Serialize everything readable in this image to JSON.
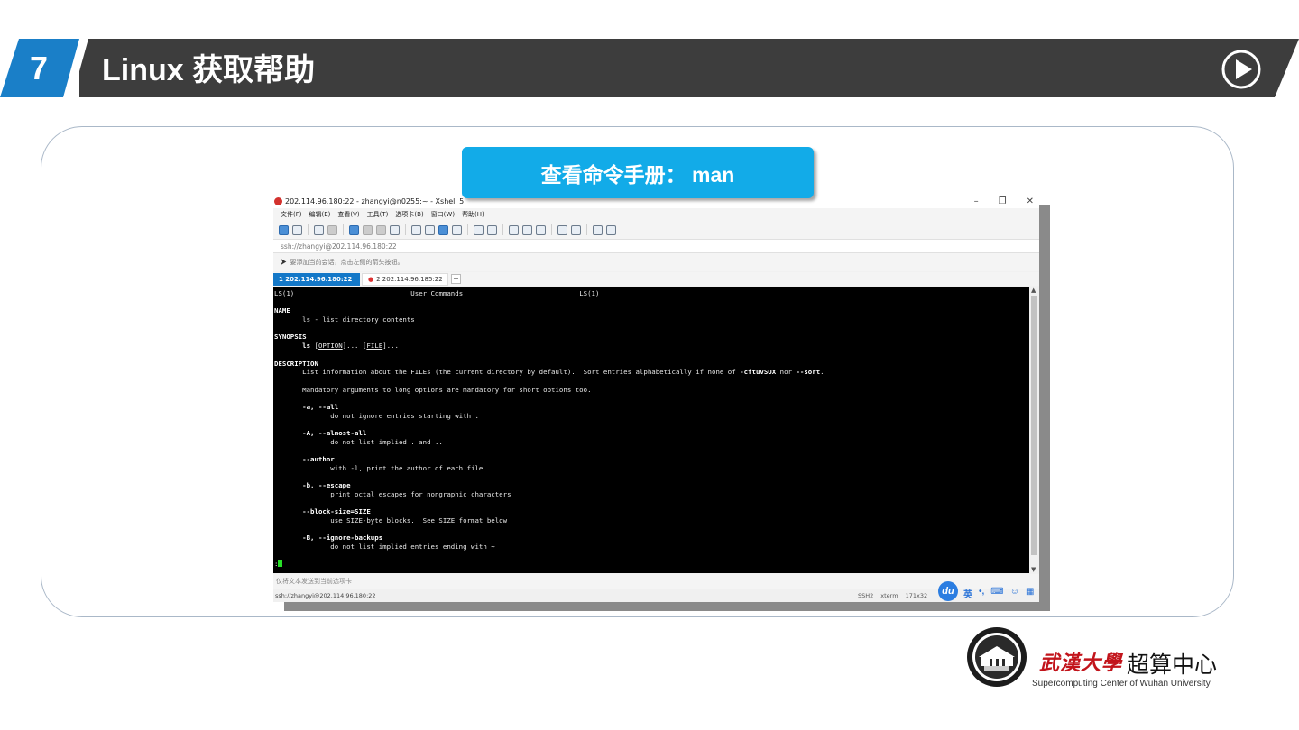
{
  "slide": {
    "number": "7",
    "title": "Linux 获取帮助",
    "caption": "查看命令手册： man"
  },
  "xshell": {
    "title": "202.114.96.180:22 - zhangyi@n0255:~ - Xshell 5",
    "window_controls": [
      "–",
      "❐",
      "✕"
    ],
    "menus": [
      "文件(F)",
      "编辑(E)",
      "查看(V)",
      "工具(T)",
      "选项卡(B)",
      "窗口(W)",
      "帮助(H)"
    ],
    "address": "ssh://zhangyi@202.114.96.180:22",
    "hint": "要添加当前会话，点击左侧的箭头按钮。",
    "tabs": [
      {
        "label": "1 202.114.96.180:22"
      },
      {
        "label": "2 202.114.96.185:22"
      }
    ],
    "tab_add": "+",
    "send_bar": "仅将文本发送到当前选项卡",
    "status_left": "ssh://zhangyi@202.114.96.180:22",
    "status_protocol": "SSH2",
    "status_term": "xterm",
    "status_size": "171x32",
    "ime_badge": "du",
    "ime_lang": "英"
  },
  "terminal": {
    "header_left": "LS(1)",
    "header_mid": "User Commands",
    "header_right": "LS(1)",
    "name_heading": "NAME",
    "name_text": "ls - list directory contents",
    "synopsis_heading": "SYNOPSIS",
    "synopsis_cmd": "ls",
    "synopsis_opt": "OPTION",
    "synopsis_file": "FILE",
    "description_heading": "DESCRIPTION",
    "desc_line1": "List information about the FILEs (the current directory by default).  Sort entries alphabetically if none of ",
    "desc_flags": "-cftuvSUX",
    "desc_nor": " nor ",
    "desc_sort": "--sort",
    "desc_line2": "Mandatory arguments to long options are mandatory for short options too.",
    "options": [
      {
        "flag": "-a, --all",
        "desc": "do not ignore entries starting with ."
      },
      {
        "flag": "-A, --almost-all",
        "desc": "do not list implied . and .."
      },
      {
        "flag": "--author",
        "desc": "with -l, print the author of each file"
      },
      {
        "flag": "-b, --escape",
        "desc": "print octal escapes for nongraphic characters"
      },
      {
        "flag": "--block-size=SIZE",
        "desc": "use SIZE-byte blocks.  See SIZE format below"
      },
      {
        "flag": "-B, --ignore-backups",
        "desc": "do not list implied entries ending with ~"
      }
    ],
    "prompt": ":"
  },
  "footer": {
    "university_cn": "武漢大學",
    "center_cn": "超算中心",
    "center_en": "Supercomputing Center of Wuhan University"
  },
  "colors": {
    "header_band": "#3d3d3d",
    "number_badge": "#1a7fc8",
    "caption_bg": "#12abe8",
    "terminal_bg": "#000000",
    "cursor": "#28e028",
    "active_tab": "#1478c8",
    "university_red": "#c2141b"
  },
  "icons": {
    "play": "play-circle-icon",
    "seal": "university-seal-icon"
  }
}
